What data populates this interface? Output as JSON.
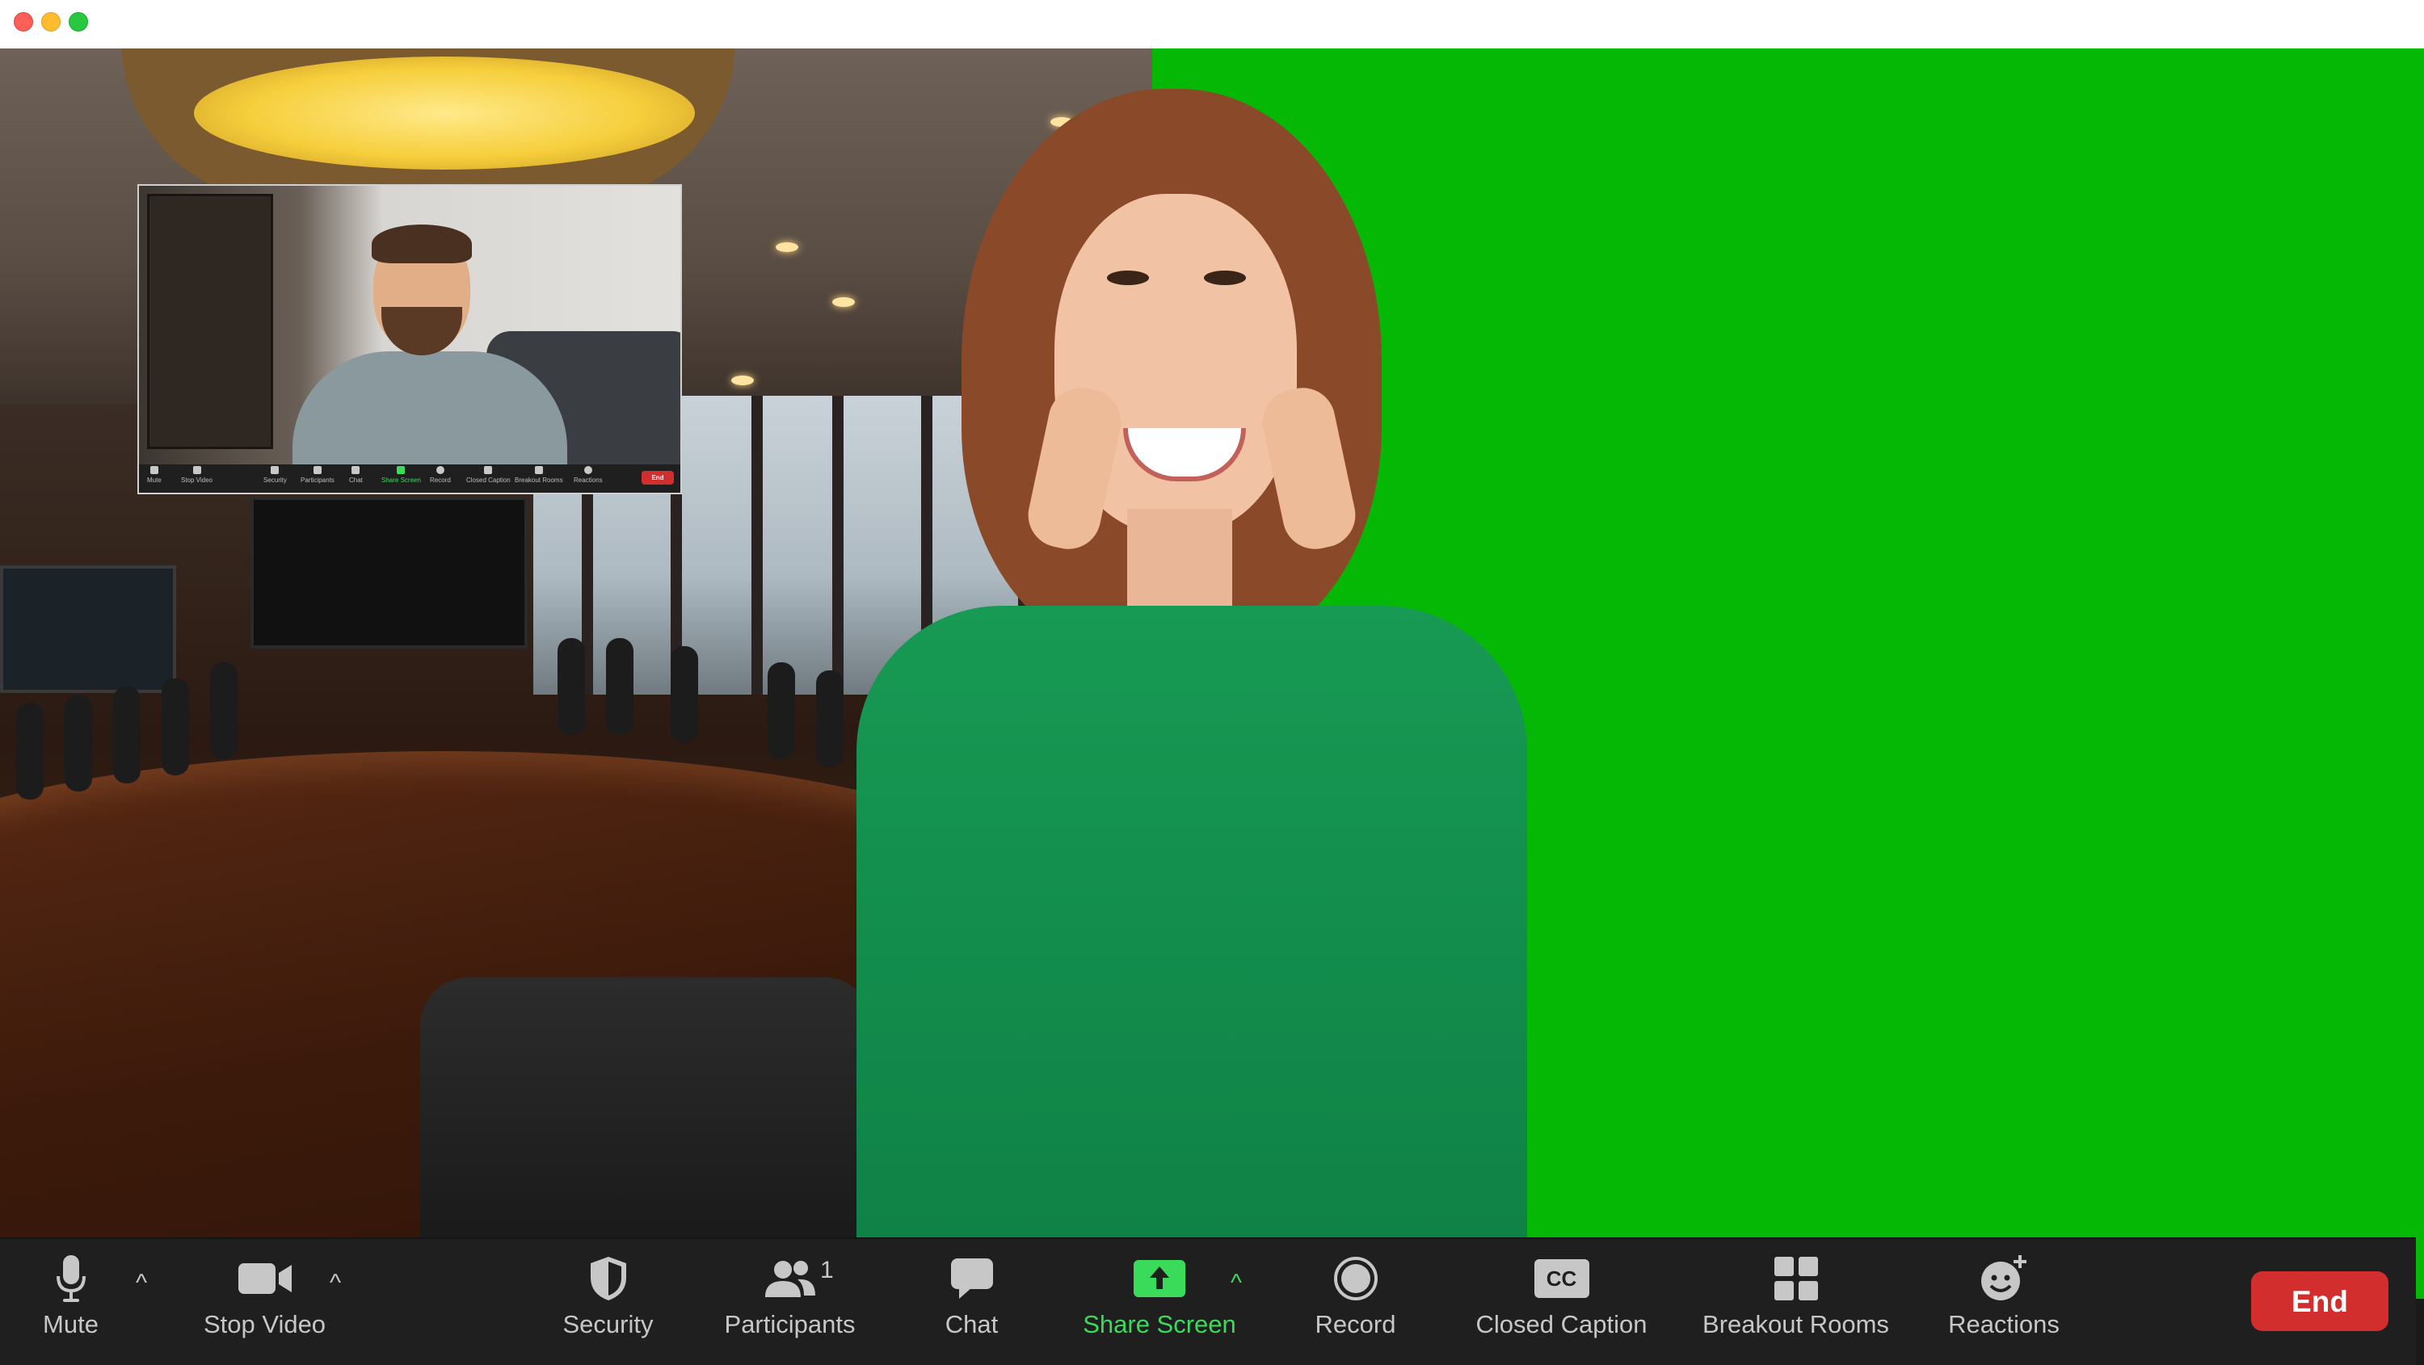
{
  "window": {
    "controls": [
      "close",
      "minimize",
      "maximize"
    ]
  },
  "pip": {
    "toolbar": [
      {
        "label": "Mute",
        "icon": "microphone-icon"
      },
      {
        "label": "Stop Video",
        "icon": "video-camera-icon"
      },
      {
        "label": "Security",
        "icon": "shield-icon"
      },
      {
        "label": "Participants",
        "icon": "participants-icon"
      },
      {
        "label": "Chat",
        "icon": "chat-bubble-icon"
      },
      {
        "label": "Share Screen",
        "icon": "share-screen-icon"
      },
      {
        "label": "Record",
        "icon": "record-icon"
      },
      {
        "label": "Closed Caption",
        "icon": "closed-caption-icon"
      },
      {
        "label": "Breakout Rooms",
        "icon": "breakout-rooms-icon"
      },
      {
        "label": "Reactions",
        "icon": "reactions-icon"
      }
    ],
    "end_label": "End"
  },
  "toolbar": {
    "mute_label": "Mute",
    "stop_video_label": "Stop Video",
    "security_label": "Security",
    "participants_label": "Participants",
    "participants_count": "1",
    "chat_label": "Chat",
    "share_screen_label": "Share Screen",
    "record_label": "Record",
    "closed_caption_label": "Closed Caption",
    "cc_badge": "CC",
    "breakout_rooms_label": "Breakout Rooms",
    "reactions_label": "Reactions",
    "end_label": "End",
    "caret_symbol": "^"
  },
  "colors": {
    "toolbar_bg": "#1f1f1f",
    "label_gray": "#c7c7c7",
    "share_green": "#3adb5a",
    "end_red": "#d32e2e",
    "green_screen": "#05b805"
  }
}
